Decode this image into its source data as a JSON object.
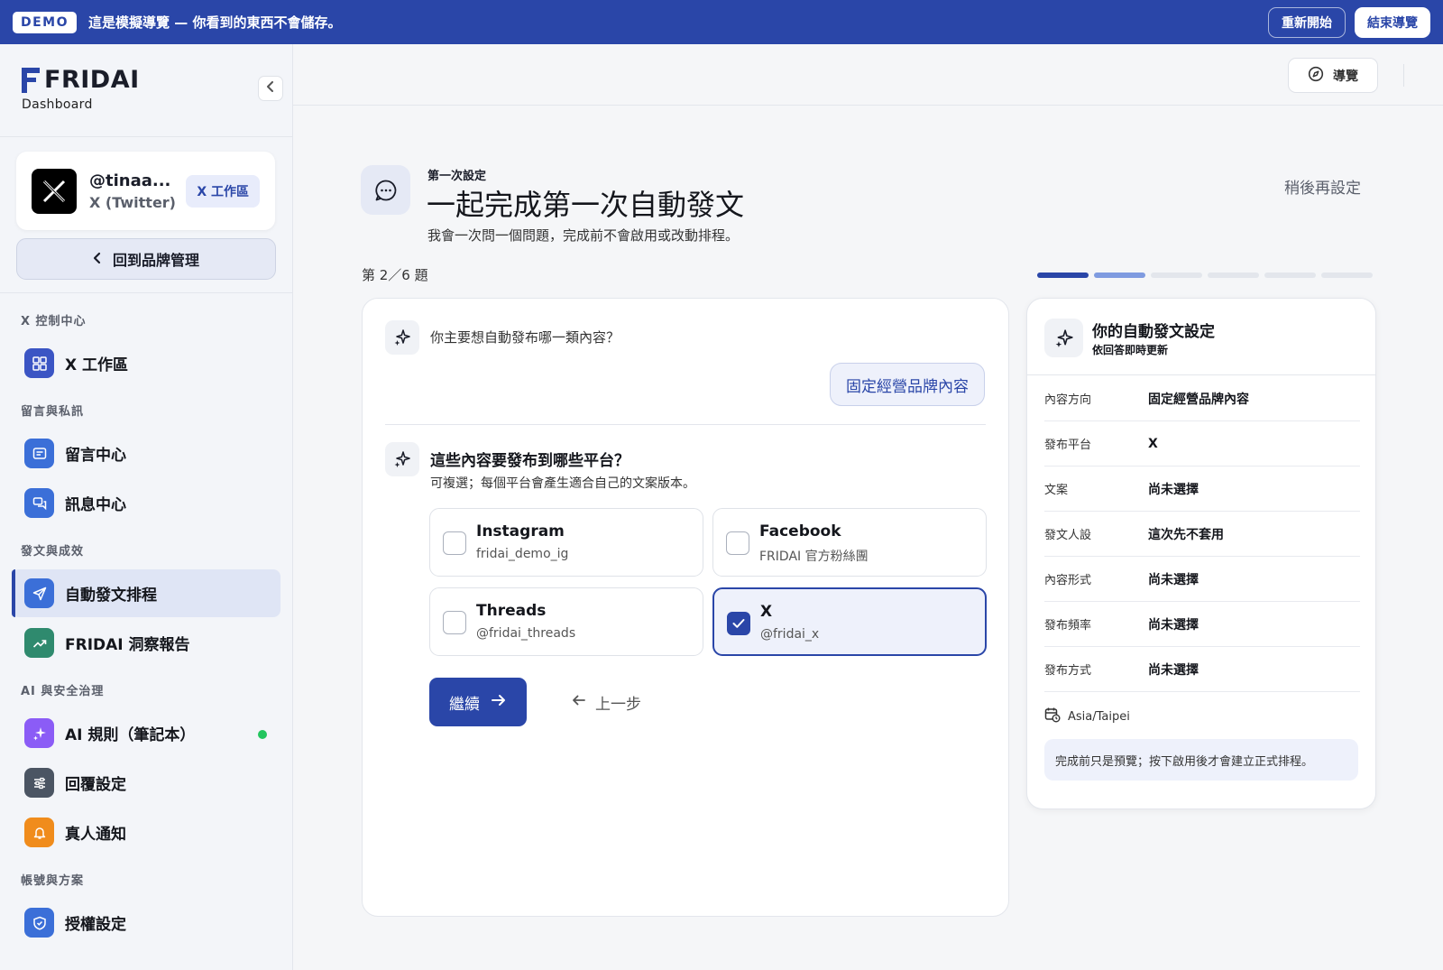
{
  "banner": {
    "badge": "DEMO",
    "message": "這是模擬導覽 — 你看到的東西不會儲存。",
    "restart_label": "重新開始",
    "end_label": "結束導覽"
  },
  "sidebar": {
    "brand_name": "FRIDAI",
    "brand_sub": "Dashboard",
    "account": {
      "handle": "@tinaa...",
      "platform": "X (Twitter)",
      "workspace_tag": "X 工作區"
    },
    "back_label": "回到品牌管理",
    "groups": [
      {
        "title": "X 控制中心",
        "items": [
          {
            "label": "X 工作區",
            "icon": "grid-icon",
            "color": "#3b55c4"
          }
        ]
      },
      {
        "title": "留言與私訊",
        "items": [
          {
            "label": "留言中心",
            "icon": "comment-icon",
            "color": "#3b6fd8"
          },
          {
            "label": "訊息中心",
            "icon": "chat-icon",
            "color": "#3b6fd8"
          }
        ]
      },
      {
        "title": "發文與成效",
        "items": [
          {
            "label": "自動發文排程",
            "icon": "send-icon",
            "color": "#3b6fd8",
            "active": true
          },
          {
            "label": "FRIDAI 洞察報告",
            "icon": "trend-icon",
            "color": "#2f8a6e"
          }
        ]
      },
      {
        "title": "AI 與安全治理",
        "items": [
          {
            "label": "AI 規則（筆記本）",
            "icon": "sparkle-icon",
            "color": "#8b5cf6",
            "status": "online"
          },
          {
            "label": "回覆設定",
            "icon": "sliders-icon",
            "color": "#4b5563"
          },
          {
            "label": "真人通知",
            "icon": "bell-icon",
            "color": "#f08c1c"
          }
        ]
      },
      {
        "title": "帳號與方案",
        "items": [
          {
            "label": "授權設定",
            "icon": "shield-icon",
            "color": "#3b6fd8"
          }
        ]
      }
    ]
  },
  "topbar": {
    "tour_label": "導覽"
  },
  "main": {
    "eyebrow": "第一次設定",
    "title": "一起完成第一次自動發文",
    "subtitle": "我會一次問一個問題，完成前不會啟用或改動排程。",
    "later_label": "稍後再設定",
    "step_label": "第 2／6 題",
    "progress": {
      "current": 2,
      "total": 6,
      "colors": [
        "#2a46a8",
        "#7f9be0",
        "#e3e6ec"
      ]
    },
    "question1": "你主要想自動發布哪一類內容？",
    "answer1": "固定經營品牌內容",
    "question2_title": "這些內容要發布到哪些平台？",
    "question2_help": "可複選；每個平台會產生適合自己的文案版本。",
    "options": [
      {
        "name": "Instagram",
        "handle": "fridai_demo_ig",
        "checked": false
      },
      {
        "name": "Facebook",
        "handle": "FRIDAI 官方粉絲團",
        "checked": false
      },
      {
        "name": "Threads",
        "handle": "@fridai_threads",
        "checked": false
      },
      {
        "name": "X",
        "handle": "@fridai_x",
        "checked": true
      }
    ],
    "continue_label": "繼續",
    "prev_label": "上一步"
  },
  "summary": {
    "title": "你的自動發文設定",
    "subtitle": "依回答即時更新",
    "rows": [
      {
        "key": "內容方向",
        "value": "固定經營品牌內容"
      },
      {
        "key": "發布平台",
        "value": "X"
      },
      {
        "key": "文案",
        "value": "尚未選擇"
      },
      {
        "key": "發文人設",
        "value": "這次先不套用"
      },
      {
        "key": "內容形式",
        "value": "尚未選擇"
      },
      {
        "key": "發布頻率",
        "value": "尚未選擇"
      },
      {
        "key": "發布方式",
        "value": "尚未選擇"
      }
    ],
    "timezone": "Asia/Taipei",
    "note": "完成前只是預覽；按下啟用後才會建立正式排程。"
  }
}
